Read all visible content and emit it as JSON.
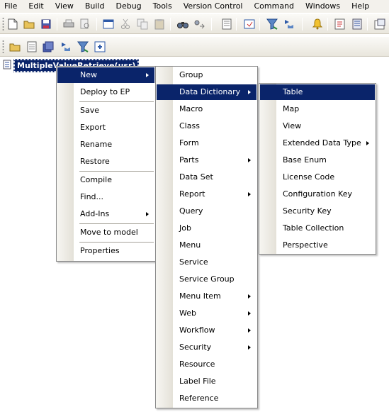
{
  "menubar": [
    "File",
    "Edit",
    "View",
    "Build",
    "Debug",
    "Tools",
    "Version Control",
    "Command",
    "Windows",
    "Help"
  ],
  "tree": {
    "node_label": "MultipleValueRetrieve(usr)"
  },
  "context_menu": {
    "items": [
      "New",
      "Deploy to EP",
      "Save",
      "Export",
      "Rename",
      "Restore",
      "Compile",
      "Find...",
      "Add-Ins",
      "Move to model",
      "Properties"
    ],
    "highlighted": "New"
  },
  "new_submenu": {
    "items": [
      "Group",
      "Data Dictionary",
      "Macro",
      "Class",
      "Form",
      "Parts",
      "Data Set",
      "Report",
      "Query",
      "Job",
      "Menu",
      "Service",
      "Service Group",
      "Menu Item",
      "Web",
      "Workflow",
      "Security",
      "Resource",
      "Label File",
      "Reference"
    ],
    "highlighted": "Data Dictionary"
  },
  "data_dictionary_submenu": {
    "items": [
      "Table",
      "Map",
      "View",
      "Extended Data Type",
      "Base Enum",
      "License Code",
      "Configuration Key",
      "Security Key",
      "Table Collection",
      "Perspective"
    ],
    "highlighted": "Table"
  },
  "colors": {
    "highlight": "#0a246a",
    "menu_bg": "#ffffff",
    "toolbar_bg": "#efece4"
  }
}
